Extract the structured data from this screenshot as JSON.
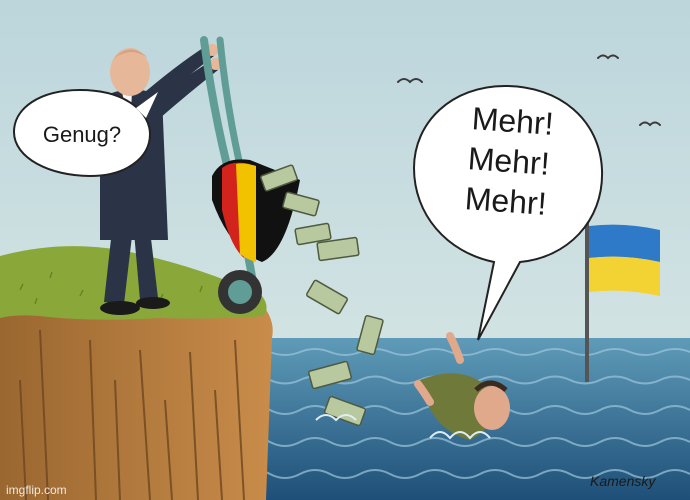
{
  "speech": {
    "left": "Genug?",
    "right_lines": [
      "Mehr!",
      "Mehr!",
      "Mehr!"
    ]
  },
  "watermark": "imgflip.com",
  "signature": "Kamensky",
  "colors": {
    "sky": "#c9dde0",
    "sea": "#2f6f93",
    "grass": "#8aa83a",
    "cliff": "#b07a3c",
    "suit": "#2b3346",
    "money": "#b8c9a0",
    "flag_de": [
      "#111111",
      "#d2231d",
      "#f2c200"
    ],
    "flag_ua": [
      "#2f79c9",
      "#f3d233"
    ]
  }
}
